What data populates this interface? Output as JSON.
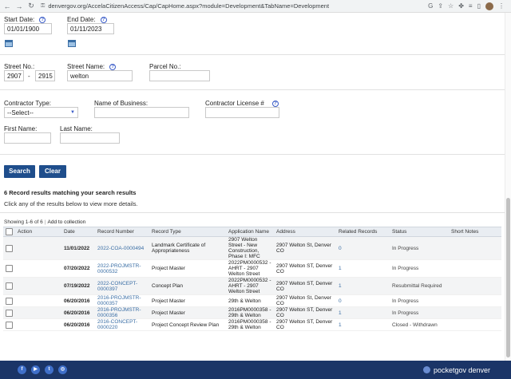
{
  "browser": {
    "url": "denvergov.org/AccelaCitizenAccess/Cap/CapHome.aspx?module=Development&TabName=Development",
    "back": "←",
    "forward": "→",
    "reload": "↻"
  },
  "form": {
    "start_date_label": "Start Date:",
    "start_date_value": "01/01/1900",
    "end_date_label": "End Date:",
    "end_date_value": "01/11/2023",
    "street_no_label": "Street No.:",
    "street_no_from": "2907",
    "street_no_dash": "-",
    "street_no_to": "2915",
    "street_name_label": "Street Name:",
    "street_name_value": "welton",
    "parcel_no_label": "Parcel No.:",
    "parcel_no_value": "",
    "contractor_type_label": "Contractor Type:",
    "contractor_type_value": "--Select--",
    "business_name_label": "Name of Business:",
    "business_name_value": "",
    "contractor_license_label": "Contractor License #",
    "contractor_license_value": "",
    "first_name_label": "First Name:",
    "first_name_value": "",
    "last_name_label": "Last Name:",
    "last_name_value": "",
    "help_glyph": "?"
  },
  "buttons": {
    "search": "Search",
    "clear": "Clear"
  },
  "results": {
    "heading": "6 Record results matching your search results",
    "instruction": "Click any of the results below to view more details.",
    "showing": "Showing 1-6 of 6",
    "separator": "|",
    "add_to_collection": "Add to collection",
    "columns": [
      "Action",
      "Date",
      "Record Number",
      "Record Type",
      "Application Name",
      "Address",
      "Related Records",
      "Status",
      "Short Notes"
    ],
    "rows": [
      {
        "date": "11/01/2022",
        "record": "2022-COA-0000494",
        "type": "Landmark Certificate of Appropriateness",
        "app": "2907 Welton Street - New Construction, Phase I: MFC",
        "address": "2907 Welton St, Denver CO",
        "related": "0",
        "status": "In Progress",
        "notes": ""
      },
      {
        "date": "07/20/2022",
        "record": "2022-PROJMSTR-0000532",
        "type": "Project Master",
        "app": "2022PM0000532 - AHRT - 2907 Welton Street",
        "address": "2907 Welton ST, Denver CO",
        "related": "1",
        "status": "In Progress",
        "notes": ""
      },
      {
        "date": "07/19/2022",
        "record": "2022-CONCEPT-0000397",
        "type": "Concept Plan",
        "app": "2022PM0000532 - AHRT - 2907 Welton Street",
        "address": "2907 Welton ST, Denver CO",
        "related": "1",
        "status": "Resubmittal Required",
        "notes": ""
      },
      {
        "date": "06/20/2016",
        "record": "2016-PROJMSTR-0000357",
        "type": "Project Master",
        "app": "29th & Welton",
        "address": "2907 Welton St, Denver CO",
        "related": "0",
        "status": "In Progress",
        "notes": ""
      },
      {
        "date": "06/20/2016",
        "record": "2016-PROJMSTR-0000356",
        "type": "Project Master",
        "app": "2016PM0000358 - 29th & Welton",
        "address": "2907 Welton ST, Denver CO",
        "related": "1",
        "status": "In Progress",
        "notes": ""
      },
      {
        "date": "06/20/2016",
        "record": "2016-CONCEPT-0000220",
        "type": "Project Concept Review Plan",
        "app": "2016PM0000358 - 29th & Welton",
        "address": "2907 Welton ST, Denver CO",
        "related": "1",
        "status": "Closed - Withdrawn",
        "notes": ""
      }
    ]
  },
  "footer": {
    "brand": "pocketgov denver",
    "social": [
      {
        "icon": "facebook-icon",
        "glyph": "f"
      },
      {
        "icon": "youtube-icon",
        "glyph": "▶"
      },
      {
        "icon": "twitter-icon",
        "glyph": "t"
      },
      {
        "icon": "instagram-icon",
        "glyph": "◎"
      }
    ]
  },
  "colors": {
    "button_blue": "#1f4e8c",
    "link_blue": "#3a6ea5",
    "footer_navy": "#1b3567"
  }
}
